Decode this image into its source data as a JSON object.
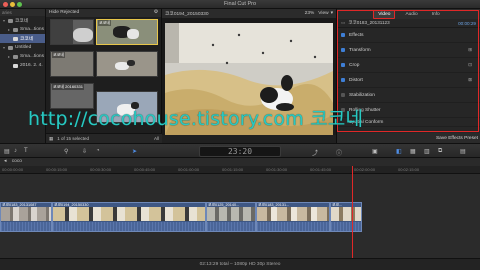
{
  "window": {
    "title": "Final Cut Pro"
  },
  "library": {
    "header": "aries",
    "items": [
      {
        "label": "코코네",
        "level": 1,
        "selected": false
      },
      {
        "label": "Sma...tions",
        "level": 2,
        "selected": false
      },
      {
        "label": "코코네",
        "level": 2,
        "selected": true
      },
      {
        "label": "Untitled",
        "level": 1,
        "selected": false
      },
      {
        "label": "Sma...tions",
        "level": 2,
        "selected": false
      },
      {
        "label": "2016. 2. 4.",
        "level": 2,
        "selected": false
      }
    ]
  },
  "browser": {
    "filter": "Hide Rejected",
    "clips": [
      {
        "label": "코코네"
      },
      {
        "label": "코코네"
      },
      {
        "label": "코코네 20160331"
      },
      {
        "label": ""
      }
    ],
    "selection_status": "1 of 15 selected",
    "view_option": "All"
  },
  "viewer": {
    "clip_name": "코코0194_20150330",
    "zoom": "23%",
    "view_menu": "View"
  },
  "inspector": {
    "tabs": [
      "Video",
      "Audio",
      "Info"
    ],
    "active_tab": "Video",
    "clip_name": "코코0183_20131123",
    "clip_timecode": "00:00:29",
    "sections": [
      {
        "label": "Effects",
        "right": ""
      },
      {
        "label": "Transform",
        "right": "⊞"
      },
      {
        "label": "Crop",
        "right": "⊡"
      },
      {
        "label": "Distort",
        "right": "⊠"
      },
      {
        "label": "Stabilization",
        "right": ""
      },
      {
        "label": "Rolling Shutter",
        "right": ""
      },
      {
        "label": "Spatial Conform",
        "right": ""
      }
    ],
    "footer_button": "Save Effects Preset"
  },
  "watermark": {
    "text": "http://cocohouse.tistory.com 코코네"
  },
  "toolbar": {
    "timecode": "23:20"
  },
  "timeline": {
    "index_label": "coco",
    "ruler_ticks": [
      "00:00:00:00",
      "00:00:15:00",
      "00:00:30:00",
      "00:00:45:00",
      "00:01:00:00",
      "00:01:15:00",
      "00:01:30:00",
      "00:01:45:00",
      "00:02:00:00",
      "00:02:15:00"
    ],
    "clips": [
      {
        "label": "코코0183_20131087"
      },
      {
        "label": "코코0194_20150330"
      },
      {
        "label": "코코0125_20140..."
      },
      {
        "label": "코코0183_20131..."
      },
      {
        "label": "코코..."
      }
    ],
    "status": "02:13:29 total – 1080p HD 30p Stereo"
  },
  "colors": {
    "accent_blue": "#4f8fe8",
    "highlight_red": "#e02828",
    "watermark": "#28c9c2",
    "selection": "#4a5d8a"
  }
}
